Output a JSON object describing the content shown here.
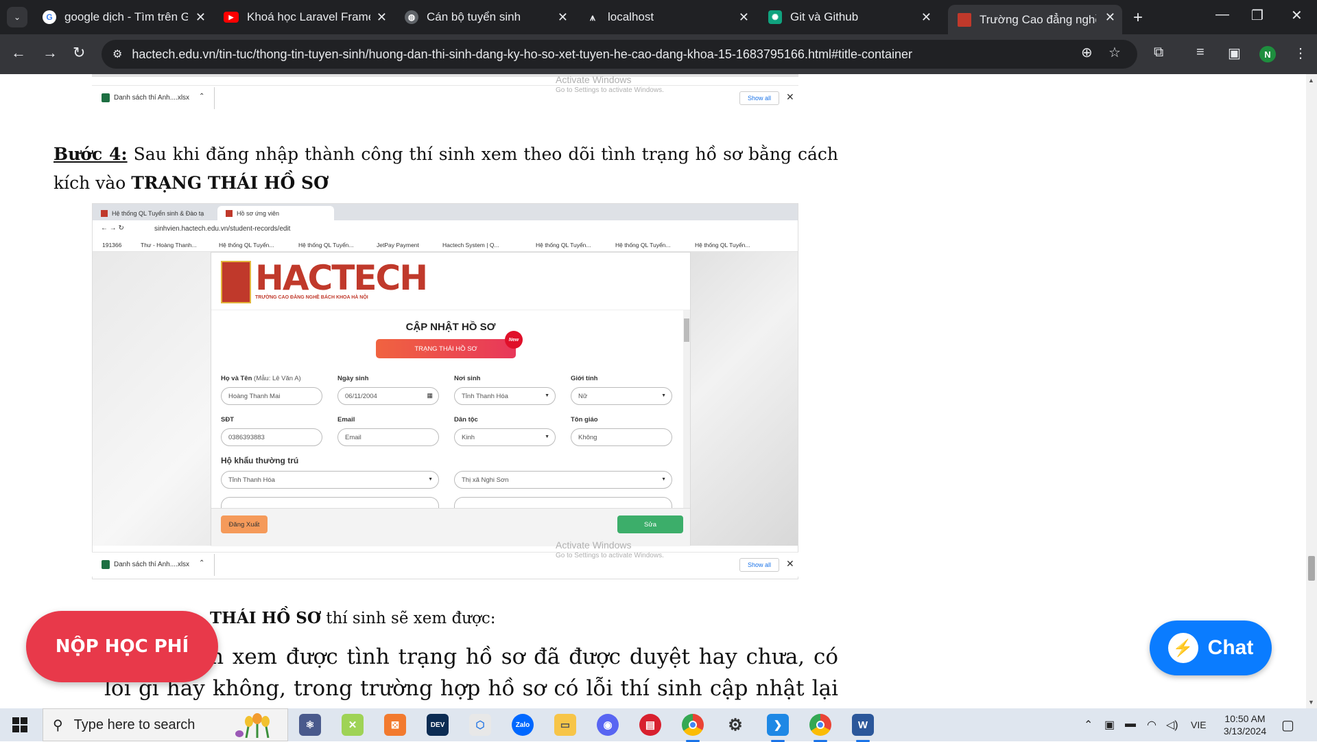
{
  "browser": {
    "tabs": [
      {
        "title": "google dịch - Tìm trên Goo",
        "icon": "google-icon",
        "color": "#ffffff"
      },
      {
        "title": "Khoá học Laravel Framewo",
        "icon": "youtube-icon",
        "color": "#ff0000"
      },
      {
        "title": "Cán bộ tuyển sinh",
        "icon": "globe-icon",
        "color": "#9aa0a6"
      },
      {
        "title": "localhost",
        "icon": "xampp-icon",
        "color": "#9aa0a6"
      },
      {
        "title": "Git và Github",
        "icon": "chatgpt-icon",
        "color": "#10a37f"
      },
      {
        "title": "Trường Cao đẳng nghề Báo",
        "icon": "hactech-icon",
        "color": "#c0392b"
      }
    ],
    "url": "hactech.edu.vn/tin-tuc/thong-tin-tuyen-sinh/huong-dan-thi-sinh-dang-ky-ho-so-xet-tuyen-he-cao-dang-khoa-15-1683795166.html#title-container",
    "profile_initial": "N"
  },
  "download_bar": {
    "file": "Danh sách thí Anh....xlsx",
    "show_all": "Show all"
  },
  "watermark": {
    "line1": "Activate Windows",
    "line2": "Go to Settings to activate Windows."
  },
  "article": {
    "step4_label": "Bước 4:",
    "step4_text": " Sau khi đăng nhập thành công thí sinh xem theo dõi tình trạng hồ sơ bằng cách kích vào ",
    "step4_bold": "TRẠNG THÁI HỒ SƠ",
    "para2_bold": "THÁI HỒ SƠ",
    "para2_text": " thí sinh sẽ xem được:",
    "para3_bold": "ơ:",
    "para3_text": " Thí sinh xem được tình trạng hồ sơ đã được duyệt hay chưa, có lỗi gì hay không, trong trường hợp hồ sơ có lỗi thí sinh cập nhật lại theo"
  },
  "screenshot": {
    "tab1": "Hệ thống QL Tuyển sinh & Đào tạ",
    "tab2": "Hồ sơ ứng viên",
    "url": "sinhvien.hactech.edu.vn/student-records/edit",
    "bookmarks": [
      "191366",
      "Thư - Hoàng Thanh...",
      "Hệ thống QL Tuyển...",
      "Hệ thống QL Tuyển...",
      "JetPay Payment",
      "Hactech System | Q...",
      "Hệ thống QL Tuyển...",
      "Hệ thống QL Tuyển...",
      "Hệ thống QL Tuyển..."
    ],
    "logo": "HACTECH",
    "logo_sub": "TRƯỜNG CAO ĐẲNG NGHỀ BÁCH KHOA HÀ NỘI",
    "form_title": "CẬP NHẬT HỒ SƠ",
    "status_button": "TRẠNG THÁI HỒ SƠ",
    "new_badge": "New",
    "fields": {
      "name_label": "Họ và Tên",
      "name_hint": "(Mẫu: Lê Văn A)",
      "name_value": "Hoàng Thanh Mai",
      "dob_label": "Ngày sinh",
      "dob_value": "06/11/2004",
      "birthplace_label": "Nơi sinh",
      "birthplace_value": "Tỉnh Thanh Hóa",
      "gender_label": "Giới tính",
      "gender_value": "Nữ",
      "phone_label": "SĐT",
      "phone_value": "0386393883",
      "email_label": "Email",
      "email_placeholder": "Email",
      "ethnic_label": "Dân tộc",
      "ethnic_value": "Kinh",
      "religion_label": "Tôn giáo",
      "religion_value": "Không",
      "household_label": "Hộ khẩu thường trú",
      "province_value": "Tỉnh Thanh Hóa",
      "district_value": "Thị xã Nghi Sơn"
    },
    "logout_button": "Đăng Xuất",
    "edit_button": "Sửa"
  },
  "widgets": {
    "pay_button": "NỘP HỌC PHÍ",
    "chat_button": "Chat"
  },
  "taskbar": {
    "search_placeholder": "Type here to search",
    "language": "VIE",
    "time": "10:50 AM",
    "date": "3/13/2024"
  }
}
